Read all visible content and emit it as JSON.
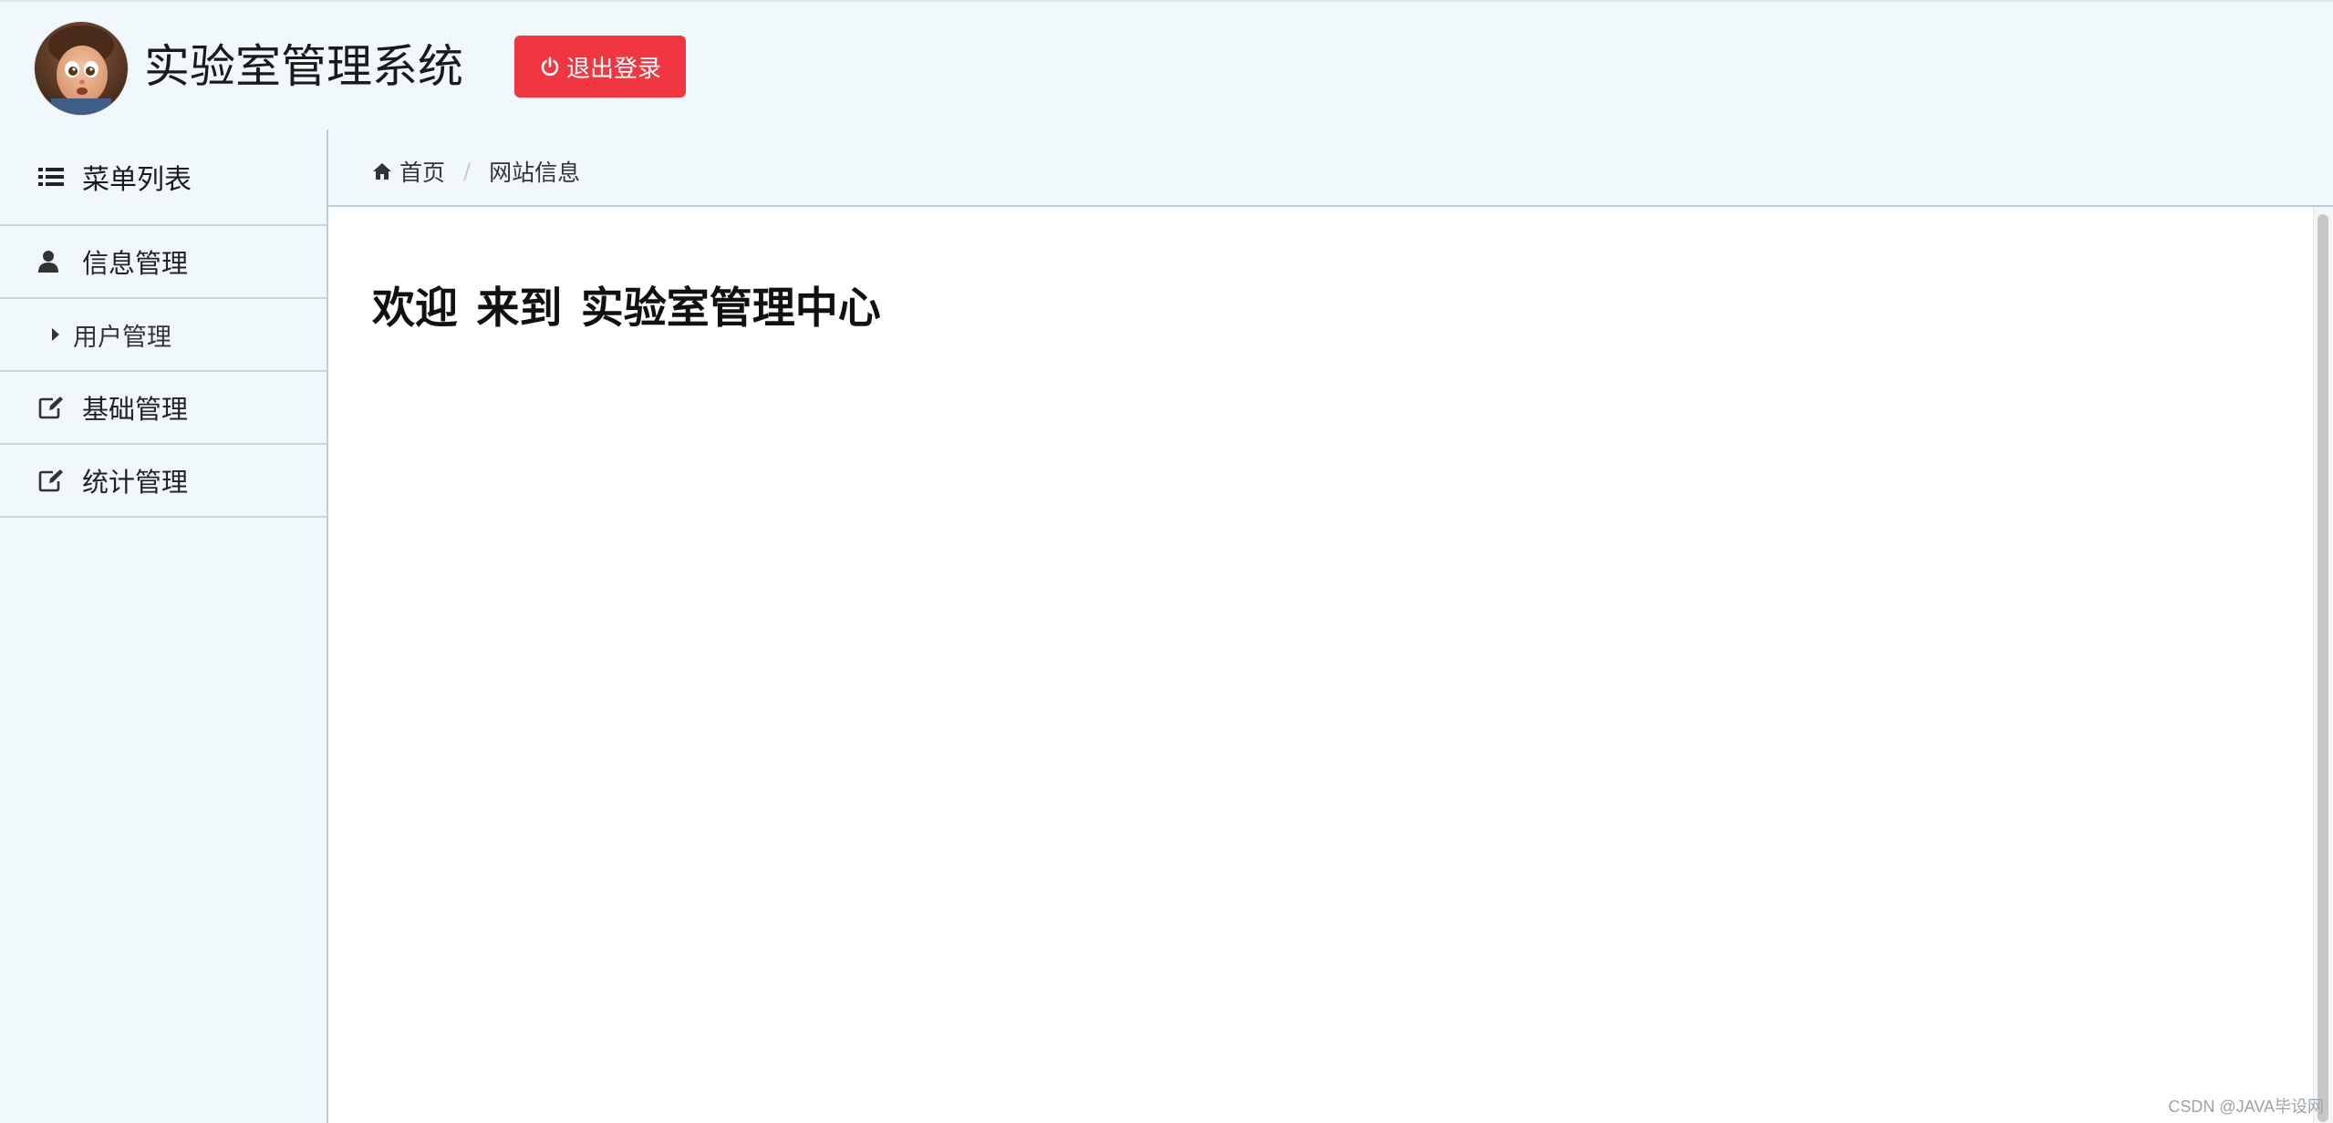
{
  "header": {
    "title": "实验室管理系统",
    "logout_label": "退出登录",
    "logout_color": "#f03640"
  },
  "sidebar": {
    "title": "菜单列表",
    "title_icon": "list-icon",
    "items": [
      {
        "label": "信息管理",
        "icon": "user-icon",
        "children": [
          {
            "label": "用户管理",
            "icon": "caret-right-icon"
          }
        ]
      },
      {
        "label": "基础管理",
        "icon": "edit-icon"
      },
      {
        "label": "统计管理",
        "icon": "edit-icon"
      }
    ]
  },
  "breadcrumb": {
    "home": "首页",
    "home_icon": "home-icon",
    "separator": "/",
    "current": "网站信息"
  },
  "main": {
    "welcome": "欢迎 来到 实验室管理中心"
  },
  "watermark": "CSDN @JAVA毕设网"
}
